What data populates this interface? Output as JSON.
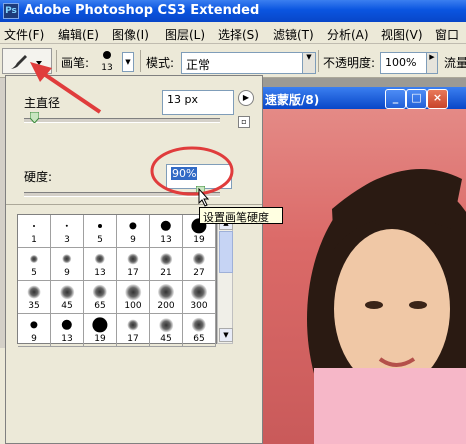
{
  "app": {
    "icon_text": "Ps",
    "title": "Adobe Photoshop CS3 Extended"
  },
  "menu": [
    "文件(F)",
    "编辑(E)",
    "图像(I)",
    "图层(L)",
    "选择(S)",
    "滤镜(T)",
    "分析(A)",
    "视图(V)",
    "窗口"
  ],
  "options": {
    "brush_label": "画笔:",
    "brush_size": "13",
    "mode_label": "模式:",
    "mode_value": "正常",
    "opacity_label": "不透明度:",
    "opacity_value": "100%",
    "flow_label": "流量"
  },
  "document": {
    "title": "速蒙版/8)"
  },
  "brush_popup": {
    "diameter_label": "主直径",
    "diameter_value": "13 px",
    "diameter_level": 0.05,
    "hardness_label": "硬度:",
    "hardness_value": "90%",
    "hardness_level": 0.9,
    "tooltip": "设置画笔硬度"
  },
  "brush_presets": [
    {
      "size": "1",
      "type": "hard"
    },
    {
      "size": "3",
      "type": "hard"
    },
    {
      "size": "5",
      "type": "hard"
    },
    {
      "size": "9",
      "type": "hard"
    },
    {
      "size": "13",
      "type": "hard"
    },
    {
      "size": "19",
      "type": "hard"
    },
    {
      "size": "5",
      "type": "soft"
    },
    {
      "size": "9",
      "type": "soft"
    },
    {
      "size": "13",
      "type": "soft"
    },
    {
      "size": "17",
      "type": "soft"
    },
    {
      "size": "21",
      "type": "soft"
    },
    {
      "size": "27",
      "type": "soft"
    },
    {
      "size": "35",
      "type": "soft"
    },
    {
      "size": "45",
      "type": "soft"
    },
    {
      "size": "65",
      "type": "soft"
    },
    {
      "size": "100",
      "type": "soft"
    },
    {
      "size": "200",
      "type": "soft"
    },
    {
      "size": "300",
      "type": "soft"
    },
    {
      "size": "9",
      "type": "hard"
    },
    {
      "size": "13",
      "type": "hard"
    },
    {
      "size": "19",
      "type": "hard"
    },
    {
      "size": "17",
      "type": "soft"
    },
    {
      "size": "45",
      "type": "soft"
    },
    {
      "size": "65",
      "type": "soft"
    }
  ],
  "colors": {
    "accent": "#0a55e0",
    "annotation": "#e03c3c",
    "canvas_bg": "#db6a68"
  }
}
